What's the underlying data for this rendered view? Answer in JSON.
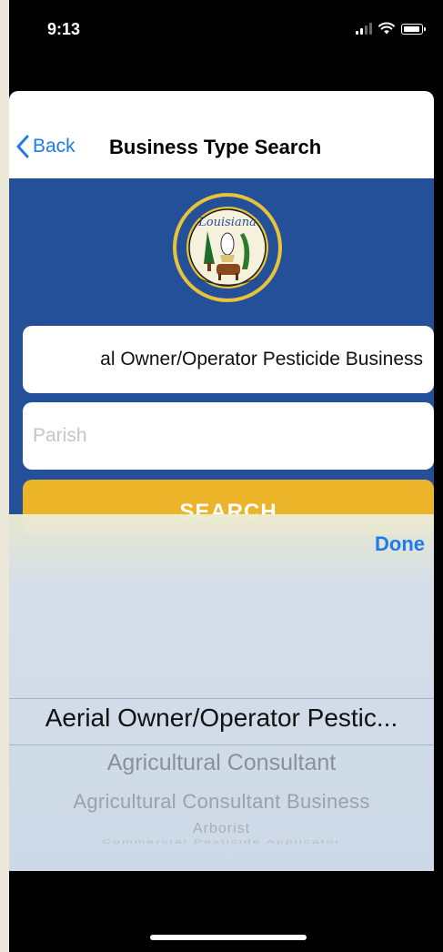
{
  "status_bar": {
    "time": "9:13"
  },
  "nav": {
    "back_label": "Back",
    "title": "Business Type Search"
  },
  "logo": {
    "text": "Louisiana",
    "ring_text": "DEPARTMENT OF AGRICULTURE AND FORESTRY"
  },
  "form": {
    "business_type_value": "al Owner/Operator Pesticide Business",
    "parish_placeholder": "Parish",
    "search_label": "SEARCH"
  },
  "picker": {
    "done_label": "Done",
    "selected": "Aerial Owner/Operator Pestic...",
    "options": [
      "Agricultural Consultant",
      "Agricultural Consultant Business",
      "Arborist",
      "Commercial Pesticide Applicator"
    ]
  },
  "colors": {
    "header_blue": "#24509a",
    "accent_blue": "#1f7aea",
    "search_yellow": "#ebb429"
  }
}
